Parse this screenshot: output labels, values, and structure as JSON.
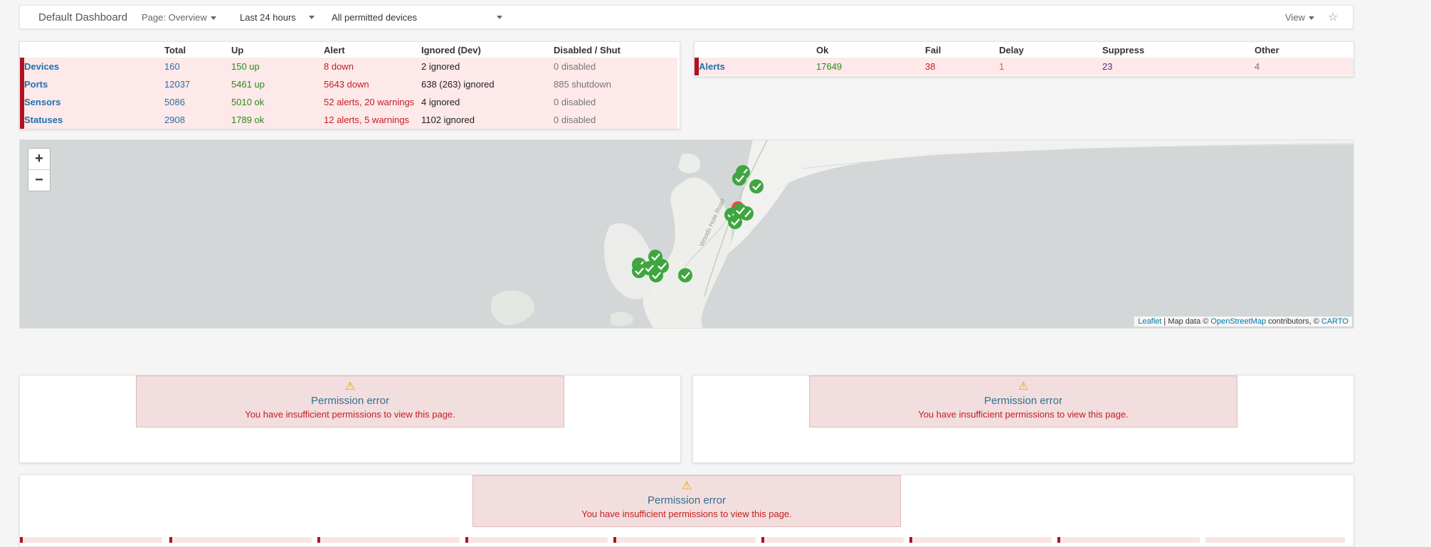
{
  "navbar": {
    "title": "Default Dashboard",
    "page_select": "Page: Overview",
    "period_select": "Last 24 hours",
    "devices_select": "All permitted devices",
    "view_label": "View",
    "star_glyph": "☆"
  },
  "summary": {
    "headers": [
      "Total",
      "Up",
      "Alert",
      "Ignored (Dev)",
      "Disabled / Shut"
    ],
    "rows": [
      {
        "label": "Devices",
        "total": "160",
        "up": "150 up",
        "alert": "8 down",
        "ignored": "2 ignored",
        "disabled": "0 disabled"
      },
      {
        "label": "Ports",
        "total": "12037",
        "up": "5461 up",
        "alert": "5643 down",
        "ignored": "638 (263) ignored",
        "disabled": "885 shutdown"
      },
      {
        "label": "Sensors",
        "total": "5086",
        "up": "5010 ok",
        "alert": "52 alerts, 20 warnings",
        "ignored": "4 ignored",
        "disabled": "0 disabled"
      },
      {
        "label": "Statuses",
        "total": "2908",
        "up": "1789 ok",
        "alert": "12 alerts, 5 warnings",
        "ignored": "1102 ignored",
        "disabled": "0 disabled"
      }
    ]
  },
  "alerts_summary": {
    "headers": [
      "Ok",
      "Fail",
      "Delay",
      "Suppress",
      "Other"
    ],
    "label": "Alerts",
    "ok": "17649",
    "fail": "38",
    "delay": "1",
    "suppress": "23",
    "other": "4"
  },
  "map": {
    "zoom_in": "+",
    "zoom_out": "−",
    "attribution": {
      "leaflet": "Leaflet",
      "sep1": " | Map data © ",
      "osm": "OpenStreetMap",
      "sep2": " contributors, © ",
      "carto": "CARTO"
    },
    "road_label": "Woods Hole Road",
    "colors": {
      "ok": "#3fa63f",
      "alert": "#e84c3d"
    }
  },
  "errors": [
    {
      "icon": "⚠",
      "title": "Permission error",
      "message": "You have insufficient permissions to view this page."
    },
    {
      "icon": "⚠",
      "title": "Permission error",
      "message": "You have insufficient permissions to view this page."
    },
    {
      "icon": "⚠",
      "title": "Permission error",
      "message": "You have insufficient permissions to view this page."
    }
  ]
}
